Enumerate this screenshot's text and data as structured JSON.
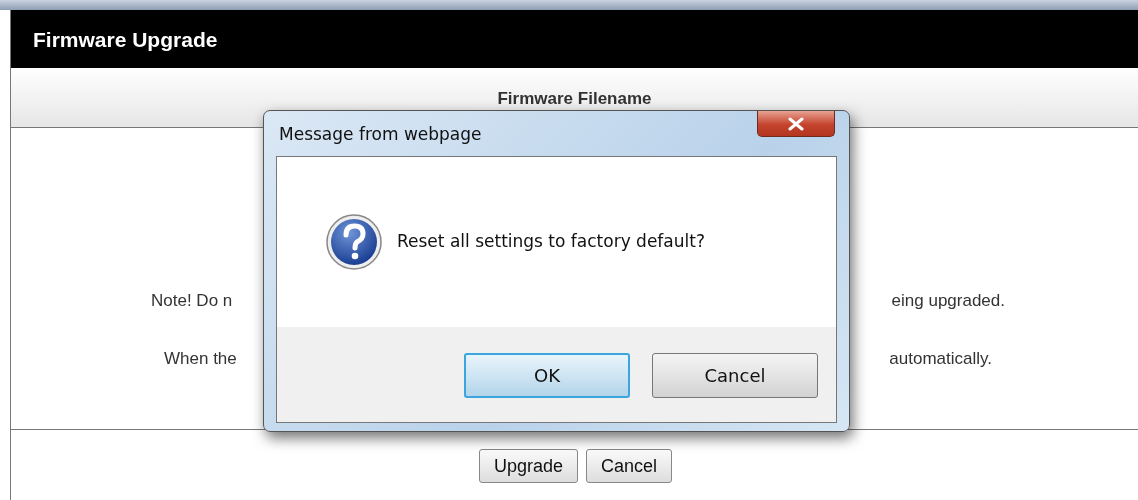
{
  "page": {
    "title": "Firmware Upgrade",
    "column_header": "Firmware Filename",
    "notes": [
      {
        "left": "Note! Do n",
        "right": "eing upgraded."
      },
      {
        "left": "When the",
        "right": "automatically."
      }
    ],
    "buttons": [
      "Upgrade",
      "Cancel"
    ]
  },
  "dialog": {
    "title": "Message from webpage",
    "message": "Reset all settings to factory default?",
    "buttons": [
      {
        "label": "OK",
        "default": true
      },
      {
        "label": "Cancel",
        "default": false
      }
    ]
  }
}
